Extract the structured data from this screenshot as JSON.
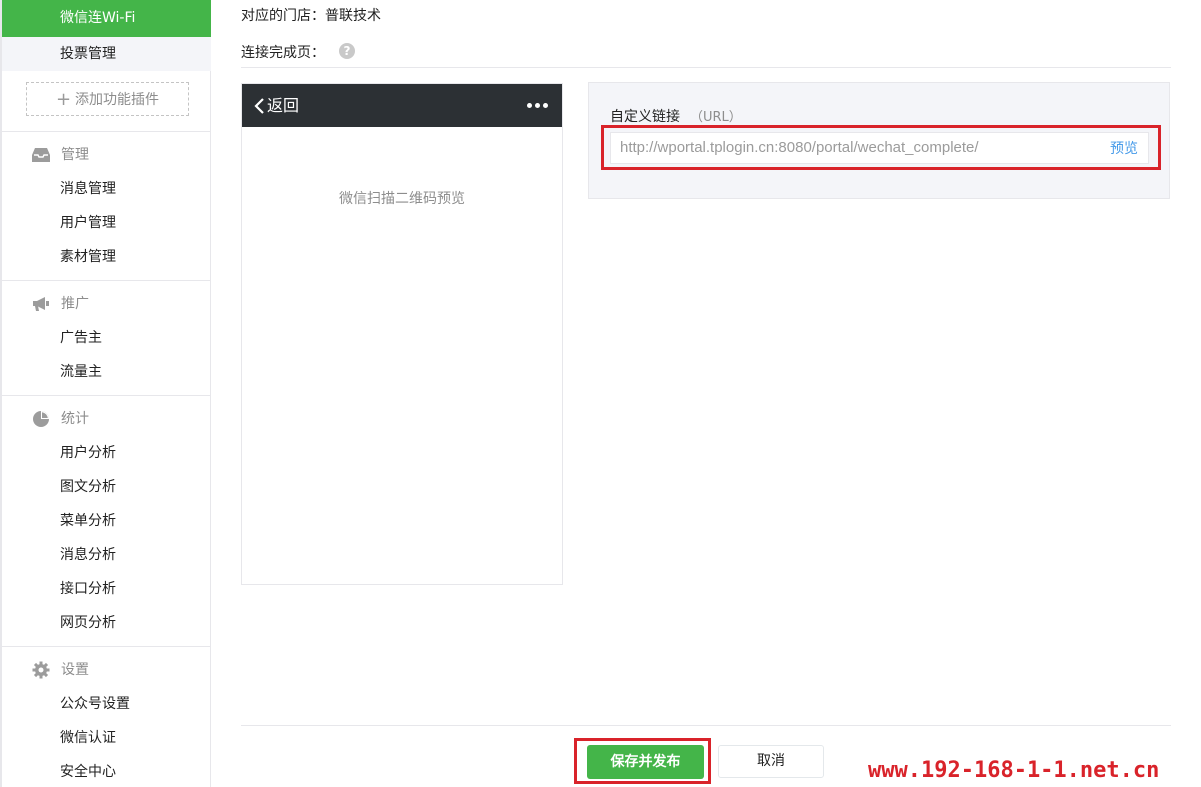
{
  "sidebar": {
    "top_items": [
      {
        "label": "微信连Wi-Fi",
        "active": true
      },
      {
        "label": "投票管理",
        "active": false
      }
    ],
    "add_plugin_label": "添加功能插件",
    "groups": [
      {
        "title": "管理",
        "icon": "inbox-icon",
        "items": [
          "消息管理",
          "用户管理",
          "素材管理"
        ]
      },
      {
        "title": "推广",
        "icon": "megaphone-icon",
        "items": [
          "广告主",
          "流量主"
        ]
      },
      {
        "title": "统计",
        "icon": "pie-chart-icon",
        "items": [
          "用户分析",
          "图文分析",
          "菜单分析",
          "消息分析",
          "接口分析",
          "网页分析"
        ]
      },
      {
        "title": "设置",
        "icon": "gear-icon",
        "items": [
          "公众号设置",
          "微信认证",
          "安全中心"
        ]
      }
    ]
  },
  "main": {
    "store_label": "对应的门店：普联技术",
    "complete_page_label": "连接完成页：",
    "help_icon_glyph": "?",
    "phone": {
      "back_label": "返回",
      "qr_preview_text": "微信扫描二维码预览"
    },
    "url_panel": {
      "label": "自定义链接",
      "label_hint": "（URL）",
      "url_value": "http://wportal.tplogin.cn:8080/portal/wechat_complete/",
      "preview_label": "预览"
    },
    "footer": {
      "save_label": "保存并发布",
      "cancel_label": "取消"
    }
  },
  "watermark": "www.192-168-1-1.net.cn",
  "colors": {
    "accent_green": "#44b549",
    "highlight_red": "#d9232a",
    "link_blue": "#459ae9",
    "phone_bar": "#2c3034"
  }
}
